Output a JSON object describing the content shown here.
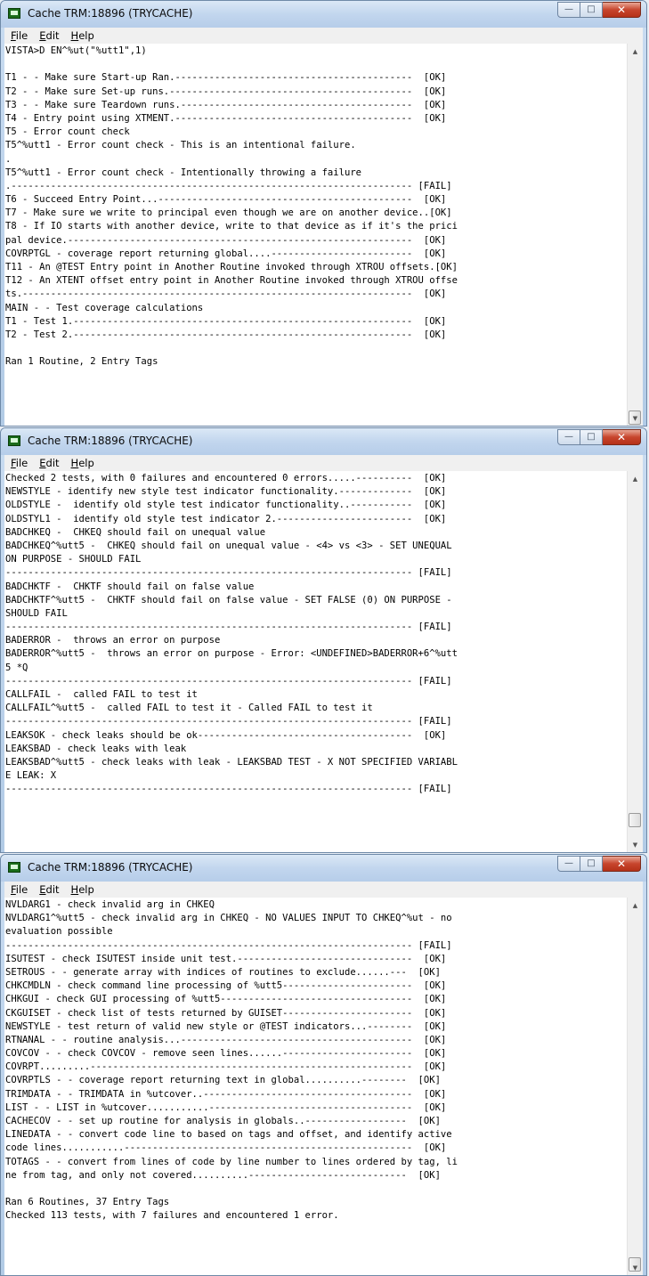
{
  "windows": [
    {
      "title": "Cache TRM:18896 (TRYCACHE)",
      "menu": [
        "File",
        "Edit",
        "Help"
      ],
      "lines": [
        "VISTA>D EN^%ut(\"%utt1\",1)",
        "",
        "T1 - - Make sure Start-up Ran.------------------------------------------  [OK]",
        "T2 - - Make sure Set-up runs.-------------------------------------------  [OK]",
        "T3 - - Make sure Teardown runs.-----------------------------------------  [OK]",
        "T4 - Entry point using XTMENT.------------------------------------------  [OK]",
        "T5 - Error count check",
        "T5^%utt1 - Error count check - This is an intentional failure.",
        ".",
        "T5^%utt1 - Error count check - Intentionally throwing a failure",
        ".----------------------------------------------------------------------- [FAIL]",
        "T6 - Succeed Entry Point...---------------------------------------------  [OK]",
        "T7 - Make sure we write to principal even though we are on another device..[OK]",
        "T8 - If IO starts with another device, write to that device as if it's the prici",
        "pal device.-------------------------------------------------------------  [OK]",
        "COVRPTGL - coverage report returning global....-------------------------  [OK]",
        "T11 - An @TEST Entry point in Another Routine invoked through XTROU offsets.[OK]",
        "T12 - An XTENT offset entry point in Another Routine invoked through XTROU offse",
        "ts.---------------------------------------------------------------------  [OK]",
        "MAIN - - Test coverage calculations",
        "T1 - Test 1.------------------------------------------------------------  [OK]",
        "T2 - Test 2.------------------------------------------------------------  [OK]",
        "",
        "Ran 1 Routine, 2 Entry Tags"
      ]
    },
    {
      "title": "Cache TRM:18896 (TRYCACHE)",
      "menu": [
        "File",
        "Edit",
        "Help"
      ],
      "lines": [
        "Checked 2 tests, with 0 failures and encountered 0 errors.....----------  [OK]",
        "NEWSTYLE - identify new style test indicator functionality.-------------  [OK]",
        "OLDSTYLE -  identify old style test indicator functionality..-----------  [OK]",
        "OLDSTYL1 -  identify old style test indicator 2.------------------------  [OK]",
        "BADCHKEQ -  CHKEQ should fail on unequal value",
        "BADCHKEQ^%utt5 -  CHKEQ should fail on unequal value - <4> vs <3> - SET UNEQUAL",
        "ON PURPOSE - SHOULD FAIL",
        "------------------------------------------------------------------------ [FAIL]",
        "BADCHKTF -  CHKTF should fail on false value",
        "BADCHKTF^%utt5 -  CHKTF should fail on false value - SET FALSE (0) ON PURPOSE -",
        "SHOULD FAIL",
        "------------------------------------------------------------------------ [FAIL]",
        "BADERROR -  throws an error on purpose",
        "BADERROR^%utt5 -  throws an error on purpose - Error: <UNDEFINED>BADERROR+6^%utt",
        "5 *Q",
        "------------------------------------------------------------------------ [FAIL]",
        "CALLFAIL -  called FAIL to test it",
        "CALLFAIL^%utt5 -  called FAIL to test it - Called FAIL to test it",
        "------------------------------------------------------------------------ [FAIL]",
        "LEAKSOK - check leaks should be ok--------------------------------------  [OK]",
        "LEAKSBAD - check leaks with leak",
        "LEAKSBAD^%utt5 - check leaks with leak - LEAKSBAD TEST - X NOT SPECIFIED VARIABL",
        "E LEAK: X",
        "------------------------------------------------------------------------ [FAIL]"
      ]
    },
    {
      "title": "Cache TRM:18896 (TRYCACHE)",
      "menu": [
        "File",
        "Edit",
        "Help"
      ],
      "lines": [
        "NVLDARG1 - check invalid arg in CHKEQ",
        "NVLDARG1^%utt5 - check invalid arg in CHKEQ - NO VALUES INPUT TO CHKEQ^%ut - no",
        "evaluation possible",
        "------------------------------------------------------------------------ [FAIL]",
        "ISUTEST - check ISUTEST inside unit test.-------------------------------  [OK]",
        "SETROUS - - generate array with indices of routines to exclude......---  [OK]",
        "CHKCMDLN - check command line processing of %utt5-----------------------  [OK]",
        "CHKGUI - check GUI processing of %utt5----------------------------------  [OK]",
        "CKGUISET - check list of tests returned by GUISET-----------------------  [OK]",
        "NEWSTYLE - test return of valid new style or @TEST indicators...--------  [OK]",
        "RTNANAL - - routine analysis...-----------------------------------------  [OK]",
        "COVCOV - - check COVCOV - remove seen lines......-----------------------  [OK]",
        "COVRPT.........---------------------------------------------------------  [OK]",
        "COVRPTLS - - coverage report returning text in global..........--------  [OK]",
        "TRIMDATA - - TRIMDATA in %utcover..-------------------------------------  [OK]",
        "LIST - - LIST in %utcover...........------------------------------------  [OK]",
        "CACHECOV - - set up routine for analysis in globals..------------------  [OK]",
        "LINEDATA - - convert code line to based on tags and offset, and identify active",
        "code lines...........---------------------------------------------------  [OK]",
        "TOTAGS - - convert from lines of code by line number to lines ordered by tag, li",
        "ne from tag, and only not covered..........----------------------------  [OK]",
        "",
        "Ran 6 Routines, 37 Entry Tags",
        "Checked 113 tests, with 7 failures and encountered 1 error."
      ]
    }
  ]
}
